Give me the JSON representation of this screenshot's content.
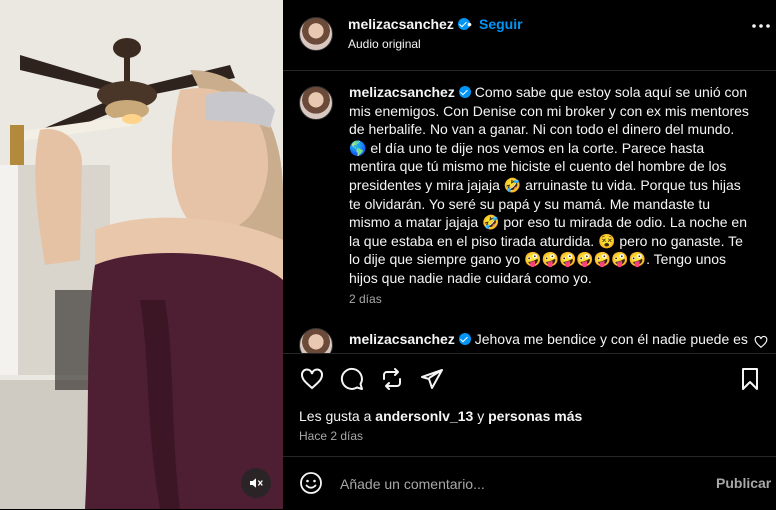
{
  "post": {
    "username": "melizacsanchez",
    "follow_label": "Seguir",
    "separator": "•",
    "audio_label": "Audio original"
  },
  "caption": {
    "username": "melizacsanchez",
    "text": "Como sabe que estoy sola aquí se unió con mis enemigos. Con Denise con mi broker y con ex mis mentores de herbalife. No van a ganar. Ni con todo el dinero del mundo. 🌎 el día uno te dije nos vemos en la corte. Parece hasta mentira que tú mismo me hiciste el cuento del hombre de los presidentes y mira jajaja 🤣 arruinaste tu vida. Porque tus hijas te olvidarán. Yo seré su papá y su mamá. Me mandaste tu mismo a matar jajaja 🤣 por eso tu mirada de odio. La noche en la que estaba en el piso tirada aturdida. 😵 pero no ganaste. Te lo dije que siempre gano yo 🤪🤪🤪🤪🤪🤪🤪. Tengo unos hijos que nadie nadie cuidará como yo.",
    "time": "2 días"
  },
  "comments": [
    {
      "username": "melizacsanchez",
      "text": "Jehova me bendice y con él nadie puede es"
    }
  ],
  "likes": {
    "prefix": "Les gusta a ",
    "user": "andersonlv_13",
    "middle": " y ",
    "others": "personas más"
  },
  "posted_ago": "Hace 2 días",
  "add_comment": {
    "placeholder": "Añade un comentario...",
    "publish_label": "Publicar"
  },
  "colors": {
    "accent": "#0095f6",
    "background": "#000000",
    "secondary_text": "#a8a8a8",
    "divider": "#262626"
  },
  "icons": [
    "mute-icon",
    "more-options-icon",
    "heart-icon",
    "comment-icon",
    "repost-icon",
    "share-icon",
    "bookmark-icon",
    "emoji-icon",
    "verified-badge-icon"
  ]
}
